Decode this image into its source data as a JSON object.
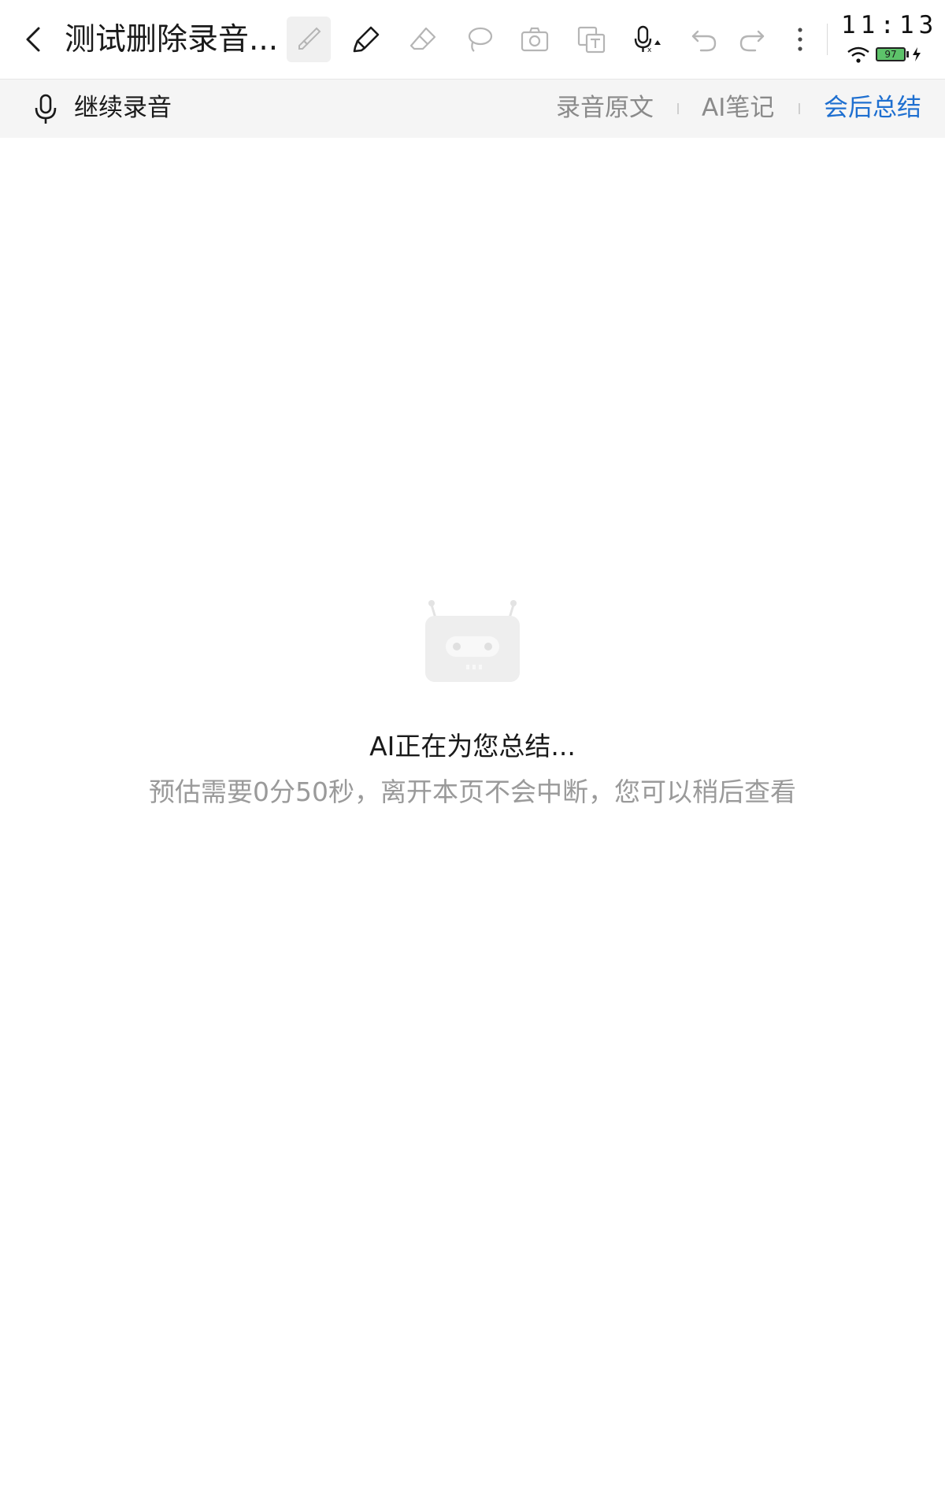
{
  "toolbar": {
    "title": "测试删除录音...",
    "tools": [
      "brush-tool",
      "highlighter-tool",
      "eraser-tool",
      "lasso-tool",
      "camera-tool",
      "text-recognition-tool",
      "voice-input-tool",
      "undo",
      "redo",
      "more-menu"
    ]
  },
  "status_bar": {
    "time": "11:13",
    "battery": "97"
  },
  "subbar": {
    "continue_recording": "继续录音",
    "tabs": [
      {
        "label": "录音原文",
        "active": false
      },
      {
        "label": "AI笔记",
        "active": false
      },
      {
        "label": "会后总结",
        "active": true
      }
    ]
  },
  "main": {
    "status_title": "AI正在为您总结...",
    "status_subtitle": "预估需要0分50秒，离开本页不会中断，您可以稍后查看"
  },
  "colors": {
    "accent": "#1e6fd0",
    "muted_text": "#9a9a9a",
    "subbar_bg": "#f5f5f5",
    "battery_fill": "#5dc36a"
  }
}
